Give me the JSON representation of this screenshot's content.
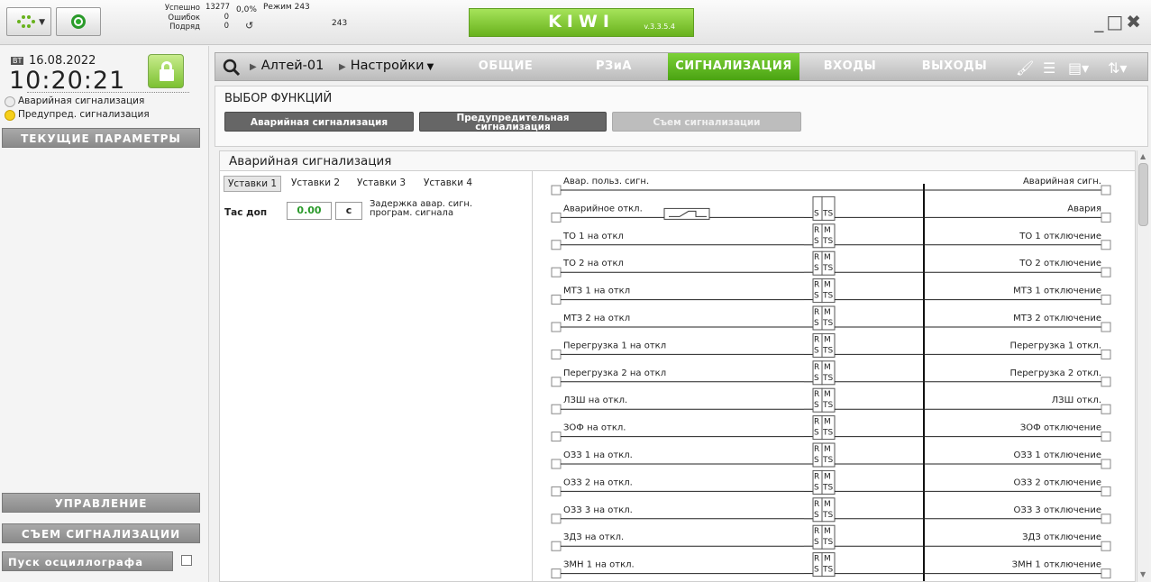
{
  "topbar": {
    "stats": {
      "success_label": "Успешно",
      "errors_label": "Ошибок",
      "retries_label": "Подряд",
      "success": "13277",
      "errors": "0",
      "retries": "0",
      "percent": "0,0%",
      "mode_label": "Режим",
      "mode_value_1": "243",
      "mode_value_2": "243"
    },
    "brand": "KIWI",
    "version": "v.3.3.5.4",
    "window_controls": "_□✖"
  },
  "left": {
    "weekday": "ВТ",
    "date": "16.08.2022",
    "time": "10:20:21",
    "alarms": [
      {
        "label": "Аварийная сигнализация",
        "state": "off"
      },
      {
        "label": "Предупред. сигнализация",
        "state": "warning"
      }
    ],
    "current_params": "ТЕКУЩИЕ ПАРАМЕТРЫ",
    "control": "УПРАВЛЕНИЕ",
    "reset_alarm": "СЪЕМ СИГНАЛИЗАЦИИ",
    "osc_start": "Пуск осциллографа"
  },
  "nav": {
    "device": "Алтей-01",
    "settings": "Настройки",
    "tabs": [
      {
        "label": "ОБЩИЕ",
        "active": false
      },
      {
        "label": "РЗиА",
        "active": false
      },
      {
        "label": "СИГНАЛИЗАЦИЯ",
        "active": true
      },
      {
        "label": "ВХОДЫ",
        "active": false
      },
      {
        "label": "ВЫХОДЫ",
        "active": false
      }
    ],
    "accent": "#5cb41d"
  },
  "functions": {
    "title": "ВЫБОР ФУНКЦИЙ",
    "buttons": [
      "Аварийная сигнализация",
      "Предупредительная сигнализация",
      "Съем сигнализации"
    ]
  },
  "content": {
    "title": "Аварийная сигнализация",
    "setting_tabs": [
      "Уставки 1",
      "Уставки 2",
      "Уставки 3",
      "Уставки 4"
    ],
    "tac": {
      "label": "Тас доп",
      "value": "0.00",
      "unit": "с",
      "description_1": "Задержка авар. сигн.",
      "description_2": "програм. сигнала"
    },
    "rs_labels": {
      "s": "S",
      "r": "R",
      "m": "M",
      "ts": "TS"
    },
    "signals": [
      {
        "in": "Авар. польз. сигн.",
        "out": "Аварийная сигн."
      },
      {
        "in": "Аварийное откл.",
        "out": "Авария"
      },
      {
        "in": "ТО 1 на откл",
        "out": "ТО 1 отключение"
      },
      {
        "in": "ТО 2 на откл",
        "out": "ТО 2 отключение"
      },
      {
        "in": "МТЗ 1 на откл",
        "out": "МТЗ 1 отключение"
      },
      {
        "in": "МТЗ 2 на откл",
        "out": "МТЗ 2 отключение"
      },
      {
        "in": "Перегрузка 1 на откл",
        "out": "Перегрузка 1 откл."
      },
      {
        "in": "Перегрузка 2 на откл",
        "out": "Перегрузка 2 откл."
      },
      {
        "in": "ЛЗШ на откл.",
        "out": "ЛЗШ откл."
      },
      {
        "in": "ЗОФ на откл.",
        "out": "ЗОФ отключение"
      },
      {
        "in": "ОЗЗ 1 на откл.",
        "out": "ОЗЗ 1 отключение"
      },
      {
        "in": "ОЗЗ 2 на откл.",
        "out": "ОЗЗ 2 отключение"
      },
      {
        "in": "ОЗЗ 3 на откл.",
        "out": "ОЗЗ 3 отключение"
      },
      {
        "in": "ЗДЗ на откл.",
        "out": "ЗДЗ отключение"
      },
      {
        "in": "ЗМН 1 на откл.",
        "out": "ЗМН 1 отключение"
      }
    ]
  }
}
